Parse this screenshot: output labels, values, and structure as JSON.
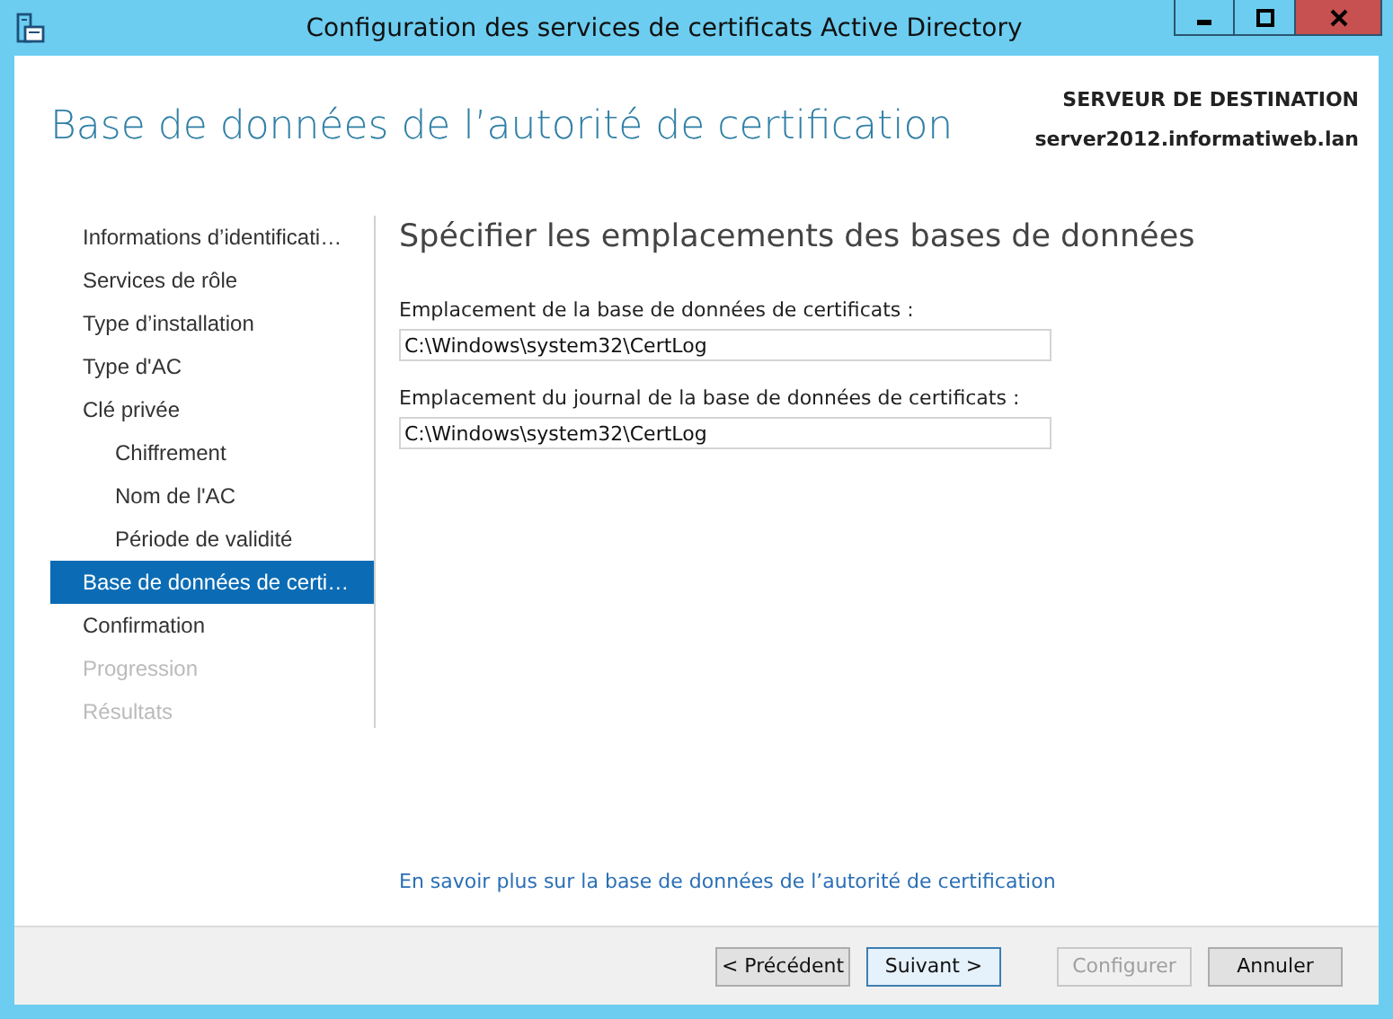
{
  "window": {
    "title": "Configuration des services de certificats Active Directory"
  },
  "header": {
    "title": "Base de données de l’autorité de certification",
    "server_label": "SERVEUR DE DESTINATION",
    "server_name": "server2012.informatiweb.lan"
  },
  "sidebar": {
    "items": [
      {
        "label": "Informations d’identificati…",
        "selected": false,
        "disabled": false
      },
      {
        "label": "Services de rôle",
        "selected": false,
        "disabled": false
      },
      {
        "label": "Type d’installation",
        "selected": false,
        "disabled": false
      },
      {
        "label": "Type d'AC",
        "selected": false,
        "disabled": false
      },
      {
        "label": "Clé privée",
        "selected": false,
        "disabled": false,
        "children": [
          {
            "label": "Chiffrement",
            "selected": false,
            "disabled": false
          },
          {
            "label": "Nom de l'AC",
            "selected": false,
            "disabled": false
          },
          {
            "label": "Période de validité",
            "selected": false,
            "disabled": false
          }
        ]
      },
      {
        "label": "Base de données de certi…",
        "selected": true,
        "disabled": false
      },
      {
        "label": "Confirmation",
        "selected": false,
        "disabled": false
      },
      {
        "label": "Progression",
        "selected": false,
        "disabled": true
      },
      {
        "label": "Résultats",
        "selected": false,
        "disabled": true
      }
    ]
  },
  "content": {
    "heading": "Spécifier les emplacements des bases de données",
    "fields": [
      {
        "label": "Emplacement de la base de données de certificats :",
        "value": "C:\\Windows\\system32\\CertLog"
      },
      {
        "label": "Emplacement du journal de la base de données de certificats :",
        "value": "C:\\Windows\\system32\\CertLog"
      }
    ],
    "link": "En savoir plus sur la base de données de l’autorité de certification"
  },
  "buttons": [
    {
      "label": "< Précédent",
      "disabled": false,
      "focused": false
    },
    {
      "label": "Suivant >",
      "disabled": false,
      "focused": true
    },
    {
      "label": "Configurer",
      "disabled": true,
      "focused": false
    },
    {
      "label": "Annuler",
      "disabled": false,
      "focused": false
    }
  ]
}
